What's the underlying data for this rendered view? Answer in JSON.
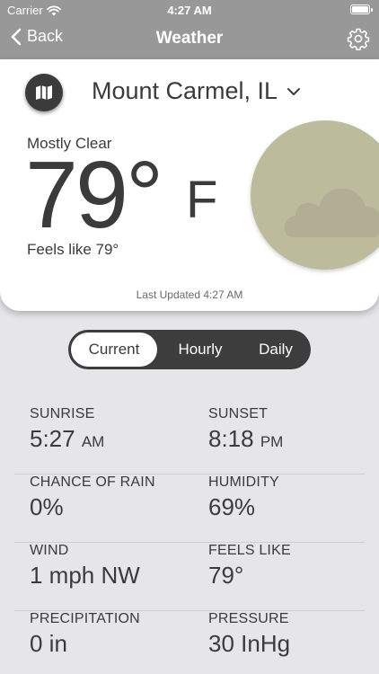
{
  "status_bar": {
    "carrier": "Carrier",
    "time": "4:27 AM"
  },
  "nav": {
    "back_label": "Back",
    "title": "Weather"
  },
  "location": {
    "name": "Mount Carmel, IL"
  },
  "current": {
    "condition": "Mostly Clear",
    "temperature": "79°",
    "unit": "F",
    "feels_like": "Feels like 79°",
    "last_updated": "Last Updated 4:27 AM"
  },
  "tabs": [
    {
      "label": "Current",
      "selected": true
    },
    {
      "label": "Hourly",
      "selected": false
    },
    {
      "label": "Daily",
      "selected": false
    }
  ],
  "details": [
    {
      "label": "SUNRISE",
      "value": "5:27",
      "unit": "AM"
    },
    {
      "label": "SUNSET",
      "value": "8:18",
      "unit": "PM"
    },
    {
      "label": "CHANCE OF RAIN",
      "value": "0%"
    },
    {
      "label": "HUMIDITY",
      "value": "69%"
    },
    {
      "label": "WIND",
      "value": "1 mph NW"
    },
    {
      "label": "FEELS LIKE",
      "value": "79°"
    },
    {
      "label": "PRECIPITATION",
      "value": "0 in"
    },
    {
      "label": "PRESSURE",
      "value": "30 InHg"
    }
  ],
  "icons": {
    "wifi": "wifi-icon",
    "battery": "battery-icon",
    "back": "chevron-left-icon",
    "settings": "gear-icon",
    "map": "map-icon",
    "location_dropdown": "chevron-down-icon",
    "weather": "cloud-icon"
  },
  "colors": {
    "header": "#989898",
    "card": "#ffffff",
    "background": "#e6e6e9",
    "text": "#3b3b3b",
    "sun_disc": "#bcbb9b",
    "segment": "#3d3d3d"
  }
}
